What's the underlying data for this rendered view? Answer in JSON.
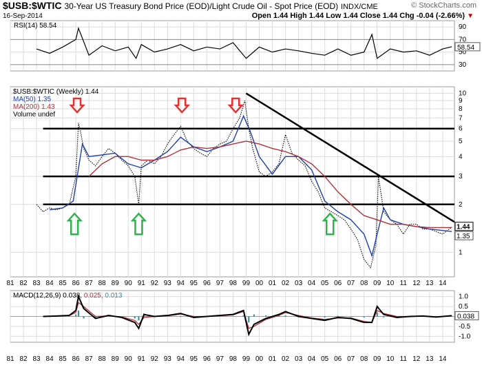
{
  "header": {
    "symbol": "$USB:$WTIC",
    "description": "30-Year US Treasury Bond Price (EOD)/Light Crude Oil - Spot Price (EOD)",
    "exchange": "INDX/CME",
    "date": "16-Sep-2014",
    "ohlc": "Open 1.44  High 1.44  Low 1.44  Close 1.44  Chg -0.04 (-2.66%)",
    "chg_arrow": "▼",
    "watermark": "© StockCharts.com"
  },
  "colors": {
    "price": "#000000",
    "ma50": "#1f3fa8",
    "ma200": "#b0303a",
    "macd": "#000000",
    "signal": "#b0303a",
    "hist": "#2a8a9a",
    "red_arrow": "#e53030",
    "green_arrow": "#2db34a",
    "grid": "#dcdcdc"
  },
  "chart_data": [
    {
      "type": "line",
      "panel": "RSI",
      "legend": "RSI(14) 58.54",
      "last_value_label": "58.54",
      "ylim": [
        20,
        100
      ],
      "yticks": [
        "90",
        "70",
        "50",
        "30"
      ],
      "reference_lines": [
        70,
        30
      ],
      "x": [
        1983.0,
        1984.0,
        1985.0,
        1986.0,
        1986.2,
        1987.0,
        1988.0,
        1989.0,
        1990.0,
        1990.6,
        1991.0,
        1992.0,
        1993.0,
        1994.0,
        1995.0,
        1996.0,
        1997.0,
        1998.0,
        1999.0,
        2000.0,
        2001.0,
        2002.0,
        2003.0,
        2004.0,
        2005.0,
        2006.0,
        2007.0,
        2008.0,
        2008.6,
        2009.0,
        2010.0,
        2011.0,
        2012.0,
        2013.0,
        2014.0,
        2014.7
      ],
      "values": [
        55,
        48,
        58,
        70,
        88,
        45,
        60,
        52,
        58,
        40,
        62,
        50,
        55,
        62,
        52,
        58,
        55,
        65,
        40,
        58,
        50,
        55,
        52,
        48,
        45,
        55,
        45,
        50,
        78,
        40,
        55,
        50,
        52,
        45,
        55,
        58.54
      ]
    },
    {
      "type": "line",
      "panel": "Price",
      "scale": "log",
      "ylim": [
        0.7,
        11
      ],
      "yticks": [
        "10",
        "9",
        "8",
        "7",
        "6",
        "5",
        "4",
        "3",
        "2",
        "1"
      ],
      "xlabels": [
        "81",
        "82",
        "83",
        "84",
        "85",
        "86",
        "87",
        "88",
        "89",
        "90",
        "91",
        "92",
        "93",
        "94",
        "95",
        "96",
        "97",
        "98",
        "99",
        "00",
        "01",
        "02",
        "03",
        "04",
        "05",
        "06",
        "07",
        "08",
        "09",
        "10",
        "11",
        "12",
        "13",
        "14"
      ],
      "xlim": [
        1981.0,
        2014.9
      ],
      "legend": [
        {
          "label": "$USB:$WTIC (Weekly) 1.44",
          "color": "#000000"
        },
        {
          "label": "MA(50) 1.35",
          "color": "#1f3fa8"
        },
        {
          "label": "MA(200) 1.43",
          "color": "#b0303a"
        },
        {
          "label": "Volume undef",
          "color": "#000000"
        }
      ],
      "last_value_labels": [
        "1.44",
        "1.35"
      ],
      "series": [
        {
          "name": "$USB:$WTIC (Weekly) 1.44",
          "x": [
            1983.0,
            1983.5,
            1984.0,
            1984.5,
            1985.0,
            1985.5,
            1986.0,
            1986.2,
            1986.4,
            1986.6,
            1987.0,
            1987.5,
            1988.0,
            1988.5,
            1989.0,
            1989.5,
            1990.0,
            1990.5,
            1990.8,
            1991.0,
            1991.5,
            1992.0,
            1992.5,
            1993.0,
            1993.5,
            1994.0,
            1994.5,
            1995.0,
            1995.5,
            1996.0,
            1996.5,
            1997.0,
            1997.5,
            1998.0,
            1998.5,
            1998.9,
            1999.2,
            1999.5,
            2000.0,
            2000.5,
            2001.0,
            2001.5,
            2002.0,
            2002.5,
            2003.0,
            2003.5,
            2004.0,
            2004.5,
            2005.0,
            2005.5,
            2006.0,
            2006.5,
            2007.0,
            2007.5,
            2008.0,
            2008.5,
            2008.9,
            2009.1,
            2009.5,
            2010.0,
            2010.5,
            2011.0,
            2011.5,
            2012.0,
            2012.5,
            2013.0,
            2013.5,
            2014.0,
            2014.7
          ],
          "values": [
            2.0,
            1.8,
            1.9,
            1.85,
            1.9,
            2.0,
            3.0,
            6.5,
            5.5,
            4.5,
            3.8,
            3.5,
            4.0,
            4.5,
            4.2,
            3.8,
            3.5,
            3.0,
            2.0,
            3.5,
            3.8,
            3.6,
            4.0,
            4.8,
            5.5,
            6.2,
            5.0,
            4.5,
            4.2,
            4.0,
            4.5,
            4.8,
            5.0,
            6.0,
            7.0,
            9.0,
            6.0,
            4.5,
            3.2,
            3.0,
            3.2,
            3.6,
            5.5,
            4.2,
            3.8,
            3.5,
            2.8,
            2.4,
            1.9,
            1.8,
            1.7,
            1.6,
            1.4,
            1.2,
            0.9,
            0.8,
            1.1,
            3.0,
            1.8,
            1.6,
            1.5,
            1.3,
            1.5,
            1.5,
            1.4,
            1.4,
            1.35,
            1.3,
            1.44
          ]
        },
        {
          "name": "MA(50) 1.35",
          "x": [
            1984.0,
            1985.0,
            1985.8,
            1986.5,
            1987.0,
            1988.0,
            1989.0,
            1990.0,
            1991.0,
            1992.0,
            1993.0,
            1994.0,
            1995.0,
            1996.0,
            1997.0,
            1998.0,
            1998.8,
            1999.3,
            2000.0,
            2001.0,
            2002.0,
            2003.0,
            2004.0,
            2005.0,
            2006.0,
            2007.0,
            2008.0,
            2008.6,
            2009.0,
            2009.5,
            2010.0,
            2011.0,
            2012.0,
            2013.0,
            2014.7
          ],
          "values": [
            1.85,
            1.9,
            2.1,
            4.8,
            4.0,
            4.1,
            4.2,
            3.6,
            3.4,
            3.8,
            4.3,
            5.3,
            4.6,
            4.3,
            4.6,
            5.0,
            7.2,
            5.8,
            4.0,
            3.1,
            4.0,
            4.0,
            3.3,
            2.1,
            1.8,
            1.6,
            1.3,
            0.95,
            1.3,
            1.9,
            1.6,
            1.5,
            1.45,
            1.4,
            1.35
          ]
        },
        {
          "name": "MA(200) 1.43",
          "x": [
            1987.0,
            1988.0,
            1989.0,
            1990.0,
            1991.0,
            1992.0,
            1993.0,
            1994.0,
            1995.0,
            1996.0,
            1997.0,
            1998.0,
            1999.0,
            2000.0,
            2001.0,
            2002.0,
            2003.0,
            2004.0,
            2005.0,
            2006.0,
            2007.0,
            2008.0,
            2009.0,
            2010.0,
            2011.0,
            2012.0,
            2013.0,
            2014.7
          ],
          "values": [
            3.0,
            3.6,
            4.0,
            4.0,
            3.8,
            3.8,
            4.0,
            4.4,
            4.6,
            4.5,
            4.6,
            4.8,
            5.0,
            4.8,
            4.5,
            4.3,
            4.0,
            3.6,
            3.0,
            2.4,
            2.0,
            1.7,
            1.6,
            1.5,
            1.5,
            1.45,
            1.43,
            1.43
          ]
        }
      ],
      "horizontal_levels": [
        6.0,
        3.0,
        2.0
      ],
      "trendline": {
        "from": [
          1999.0,
          10.0
        ],
        "to": [
          2014.9,
          1.55
        ]
      },
      "annotations": [
        {
          "kind": "red-down-arrow",
          "x": 1986.1
        },
        {
          "kind": "red-down-arrow",
          "x": 1994.1
        },
        {
          "kind": "red-down-arrow",
          "x": 1998.2
        },
        {
          "kind": "green-up-arrow",
          "x": 1985.9
        },
        {
          "kind": "green-up-arrow",
          "x": 1990.8
        },
        {
          "kind": "green-up-arrow",
          "x": 2005.4
        }
      ]
    },
    {
      "type": "line",
      "panel": "MACD",
      "legend": [
        {
          "label": "MACD(12,26,9)",
          "value": "0.038",
          "color": "#000000"
        },
        {
          "label": "",
          "value": "0.025",
          "color": "#b0303a"
        },
        {
          "label": "",
          "value": "0.013",
          "color": "#2a8a9a"
        }
      ],
      "last_value_label": "0.038",
      "ylim": [
        -1.3,
        1.3
      ],
      "yticks": [
        "1.0",
        "0.5",
        "0.0",
        "-0.5",
        "-1.0"
      ],
      "x": [
        1983.5,
        1984.5,
        1985.5,
        1986.0,
        1986.2,
        1986.6,
        1987.5,
        1988.5,
        1989.5,
        1990.5,
        1990.8,
        1991.2,
        1992.0,
        1993.0,
        1994.0,
        1995.0,
        1996.0,
        1997.0,
        1998.0,
        1998.8,
        1999.2,
        1999.6,
        2000.5,
        2001.5,
        2002.0,
        2003.0,
        2004.0,
        2005.0,
        2006.0,
        2007.0,
        2008.0,
        2008.6,
        2009.0,
        2009.5,
        2010.5,
        2011.5,
        2012.5,
        2013.5,
        2014.7
      ],
      "macd": [
        0.0,
        0.02,
        0.05,
        0.3,
        1.0,
        0.4,
        -0.1,
        0.05,
        -0.05,
        -0.3,
        -0.6,
        0.1,
        0.0,
        0.05,
        0.15,
        -0.05,
        0.0,
        0.05,
        0.1,
        0.3,
        -0.9,
        -0.4,
        -0.1,
        0.1,
        0.25,
        0.0,
        -0.1,
        -0.2,
        -0.05,
        -0.1,
        -0.3,
        -0.3,
        0.5,
        0.1,
        -0.05,
        0.0,
        0.02,
        -0.03,
        0.038
      ],
      "signal": [
        0.0,
        0.01,
        0.04,
        0.2,
        0.7,
        0.5,
        0.0,
        0.03,
        -0.02,
        -0.2,
        -0.4,
        -0.05,
        0.0,
        0.03,
        0.12,
        0.0,
        0.0,
        0.03,
        0.08,
        0.25,
        -0.6,
        -0.5,
        -0.15,
        0.05,
        0.2,
        0.05,
        -0.08,
        -0.15,
        -0.08,
        -0.08,
        -0.25,
        -0.3,
        0.3,
        0.15,
        0.0,
        0.0,
        0.01,
        -0.01,
        0.025
      ]
    }
  ]
}
